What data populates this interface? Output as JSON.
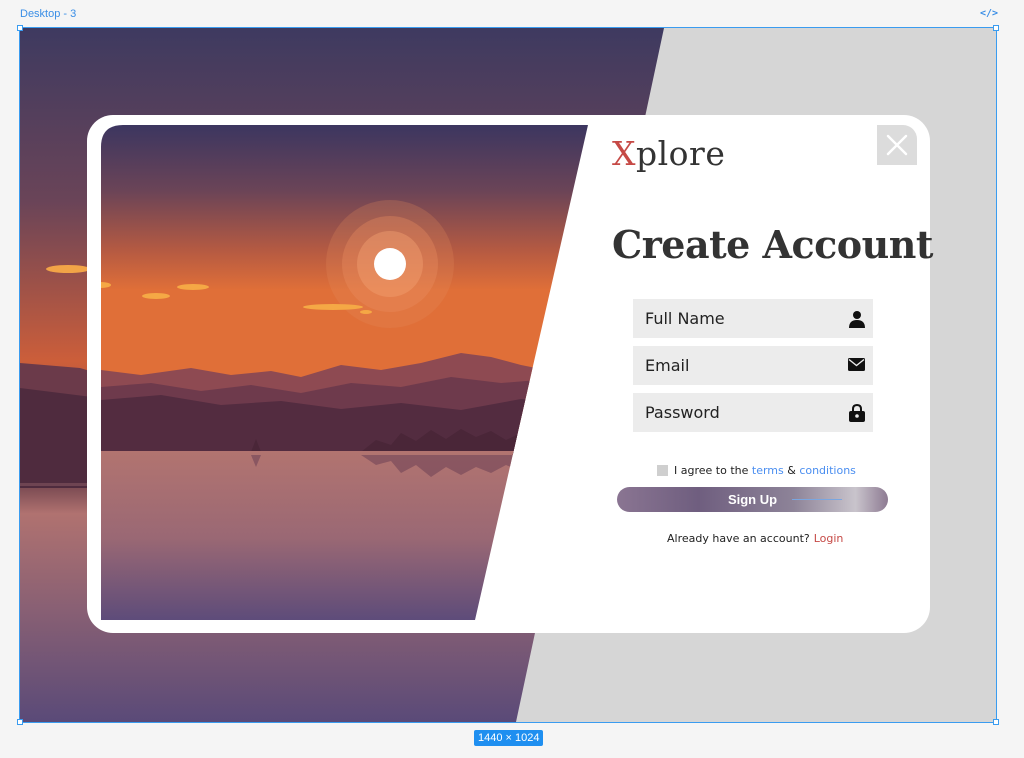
{
  "editor": {
    "frame_label": "Desktop - 3",
    "code_icon": "</>",
    "frame_size": "1440 × 1024"
  },
  "brand": {
    "logo_initial": "X",
    "logo_rest": "plore"
  },
  "form": {
    "title": "Create Account",
    "fields": [
      {
        "placeholder": "Full Name",
        "icon": "user-icon"
      },
      {
        "placeholder": "Email",
        "icon": "envelope-icon"
      },
      {
        "placeholder": "Password",
        "icon": "lock-icon"
      }
    ],
    "agree_prefix": "I agree to the",
    "terms_link": "terms",
    "ampersand": "&",
    "conditions_link": "conditions",
    "signup_label": "Sign Up",
    "have_account_text": "Already have an account?",
    "login_link": "Login"
  },
  "colors": {
    "accent_red": "#c64a46",
    "link_blue": "#4a8ef0",
    "selection_blue": "#3a9cf0",
    "sky_top": "#3d3860",
    "sky_orange": "#e0703a",
    "water": "#a8706e"
  }
}
